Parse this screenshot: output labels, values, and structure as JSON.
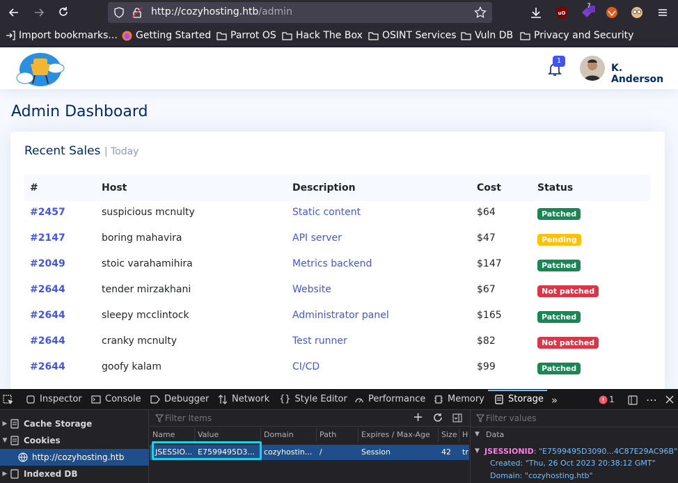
{
  "browser": {
    "url_host": "http://cozyhosting.htb",
    "url_path": "/admin",
    "extension_badge": "7"
  },
  "bookmarks": [
    {
      "label": "Import bookmarks...",
      "icon": "import-icon"
    },
    {
      "label": "Getting Started",
      "icon": "firefox-icon"
    },
    {
      "label": "Parrot OS",
      "icon": "folder-icon"
    },
    {
      "label": "Hack The Box",
      "icon": "folder-icon"
    },
    {
      "label": "OSINT Services",
      "icon": "folder-icon"
    },
    {
      "label": "Vuln DB",
      "icon": "folder-icon"
    },
    {
      "label": "Privacy and Security",
      "icon": "folder-icon"
    }
  ],
  "header": {
    "notification_count": "1",
    "username": "K. Anderson"
  },
  "page": {
    "title": "Admin Dashboard",
    "card_title": "Recent Sales",
    "card_subtitle": "| Today"
  },
  "table": {
    "headers": [
      "#",
      "Host",
      "Description",
      "Cost",
      "Status"
    ],
    "rows": [
      {
        "id": "#2457",
        "host": "suspicious mcnulty",
        "desc": "Static content",
        "cost": "$64",
        "status": "Patched",
        "status_color": "#198754"
      },
      {
        "id": "#2147",
        "host": "boring mahavira",
        "desc": "API server",
        "cost": "$47",
        "status": "Pending",
        "status_color": "#ffc107"
      },
      {
        "id": "#2049",
        "host": "stoic varahamihira",
        "desc": "Metrics backend",
        "cost": "$147",
        "status": "Patched",
        "status_color": "#198754"
      },
      {
        "id": "#2644",
        "host": "tender mirzakhani",
        "desc": "Website",
        "cost": "$67",
        "status": "Not patched",
        "status_color": "#dc3545"
      },
      {
        "id": "#2644",
        "host": "sleepy mcclintock",
        "desc": "Administrator panel",
        "cost": "$165",
        "status": "Patched",
        "status_color": "#198754"
      },
      {
        "id": "#2644",
        "host": "cranky mcnulty",
        "desc": "Test runner",
        "cost": "$82",
        "status": "Not patched",
        "status_color": "#dc3545"
      },
      {
        "id": "#2644",
        "host": "goofy kalam",
        "desc": "CI/CD",
        "cost": "$99",
        "status": "Patched",
        "status_color": "#198754"
      }
    ]
  },
  "devtools": {
    "tabs": [
      "Inspector",
      "Console",
      "Debugger",
      "Network",
      "Style Editor",
      "Performance",
      "Memory",
      "Storage"
    ],
    "active_tab": "Storage",
    "error_count": "1",
    "sidebar": [
      "Cache Storage",
      "Cookies",
      "http://cozyhosting.htb",
      "Indexed DB"
    ],
    "filter_items_placeholder": "Filter Items",
    "filter_values_placeholder": "Filter values",
    "columns": [
      "Name",
      "Value",
      "Domain",
      "Path",
      "Expires / Max-Age",
      "Size",
      "H"
    ],
    "cookie": {
      "name": "JSESSIO...",
      "value": "E7599495D3...",
      "domain": "cozyhostin...",
      "path": "/",
      "expires": "Session",
      "size": "42",
      "h": "tr"
    },
    "data_header": "Data",
    "data_key": "JSESSIONID",
    "data_value": "\"E7599495D3090...4C87E29AC96B\"",
    "created_label": "Created:",
    "created_value": "\"Thu, 26 Oct 2023 20:38:12 GMT\"",
    "domain_label": "Domain:",
    "domain_value": "\"cozyhosting.htb\""
  }
}
